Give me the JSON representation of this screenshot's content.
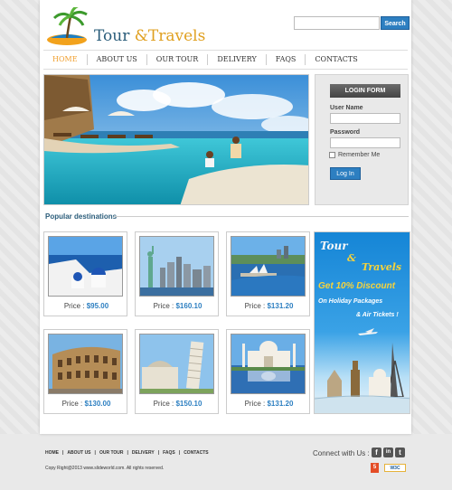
{
  "brand": {
    "name_part1": "Tour ",
    "name_amp": "&",
    "name_part2": "Travels"
  },
  "search": {
    "placeholder": "",
    "button_label": "Search"
  },
  "nav": {
    "items": [
      {
        "label": "HOME",
        "active": true
      },
      {
        "label": "ABOUT US",
        "active": false
      },
      {
        "label": "OUR TOUR",
        "active": false
      },
      {
        "label": "DELIVERY",
        "active": false
      },
      {
        "label": "FAQS",
        "active": false
      },
      {
        "label": "CONTACTS",
        "active": false
      }
    ]
  },
  "login": {
    "title": "LOGIN FORM",
    "username_label": "User Name",
    "password_label": "Password",
    "remember_label": "Remember Me",
    "button_label": "Log In"
  },
  "popular": {
    "title": "Popular destinations",
    "price_prefix": "Price : ",
    "cards": [
      {
        "price": "$95.00",
        "place": "santorini"
      },
      {
        "price": "$160.10",
        "place": "new-york"
      },
      {
        "price": "$131.20",
        "place": "sydney"
      },
      {
        "price": "$130.00",
        "place": "colosseum"
      },
      {
        "price": "$150.10",
        "place": "pisa"
      },
      {
        "price": "$131.20",
        "place": "taj-mahal"
      }
    ]
  },
  "promo": {
    "tour": "Tour",
    "amp": "&",
    "travels": "Travels",
    "offer": "Get 10% Discount",
    "line1": "On Holiday Packages",
    "line2": "& Air Tickets !"
  },
  "footer": {
    "links": [
      "HOME",
      "ABOUT US",
      "OUR TOUR",
      "DELIVERY",
      "FAQS",
      "CONTACTS"
    ],
    "copyright": "Copy Right@2013 www.slideworld.com. All rights reserved.",
    "connect_label": "Connect with Us :",
    "social": [
      {
        "icon": "facebook-icon",
        "glyph": "f"
      },
      {
        "icon": "linkedin-icon",
        "glyph": "in"
      },
      {
        "icon": "tumblr-icon",
        "glyph": "t"
      }
    ],
    "badges": {
      "html5": "5",
      "w3c": "W3C"
    }
  },
  "colors": {
    "accent_blue": "#2d7fc1",
    "nav_active": "#f0a030",
    "brand_blue": "#2a5c7a",
    "gold": "#e0a020"
  }
}
